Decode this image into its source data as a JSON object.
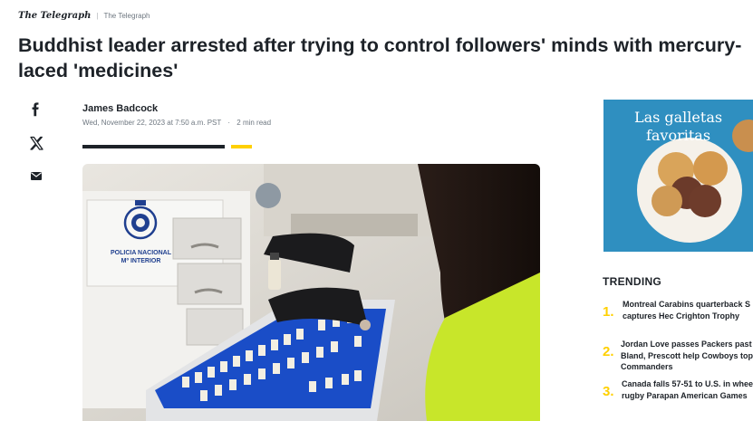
{
  "publisher": {
    "logo": "The Telegraph",
    "name": "The Telegraph"
  },
  "headline": "Buddhist leader arrested after trying to control followers' minds with mercury-laced 'medicines'",
  "share": {
    "icons": [
      "facebook-icon",
      "x-icon",
      "email-icon"
    ]
  },
  "article": {
    "author": "James Badcock",
    "date": "Wed, November 22, 2023 at 7:50 a.m. PST",
    "read_time": "2 min read"
  },
  "photo": {
    "badge_line1": "POLICIA NACIONAL",
    "badge_line2": "Mº INTERIOR"
  },
  "ad": {
    "text_line1": "Las galletas",
    "text_line2": "favoritas"
  },
  "trending": {
    "title": "TRENDING",
    "items": [
      {
        "num": "1.",
        "line1": "Montreal Carabins quarterback S",
        "line2": "captures Hec Crighton Trophy"
      },
      {
        "num": "2.",
        "line1": "Jordan Love passes Packers past",
        "line2": "Bland, Prescott help Cowboys top",
        "line3": "Commanders"
      },
      {
        "num": "3.",
        "line1": "Canada falls 57-51 to U.S. in whee",
        "line2": "rugby Parapan American Games"
      }
    ]
  },
  "colors": {
    "accent_yellow": "#ffd000",
    "text": "#1d2228",
    "muted": "#6e7780"
  }
}
